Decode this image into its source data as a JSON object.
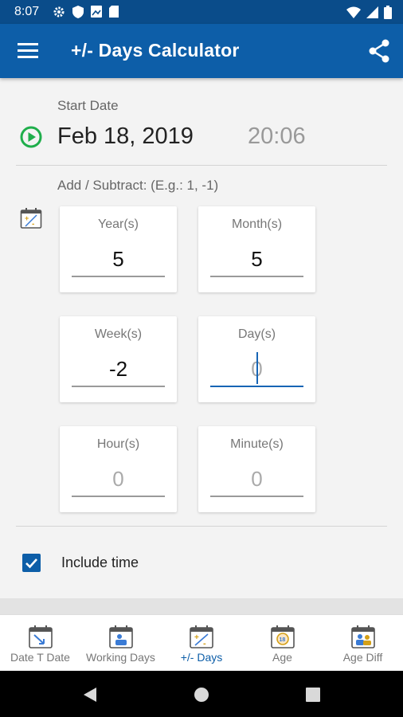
{
  "status_bar": {
    "time": "8:07"
  },
  "app_bar": {
    "title": "+/- Days Calculator"
  },
  "start": {
    "label": "Start Date",
    "date": "Feb 18, 2019",
    "time": "20:06"
  },
  "add_subtract": {
    "label": "Add / Subtract: (E.g.: 1, -1)"
  },
  "fields": {
    "years": {
      "label": "Year(s)",
      "value": "5",
      "placeholder": "0"
    },
    "months": {
      "label": "Month(s)",
      "value": "5",
      "placeholder": "0"
    },
    "weeks": {
      "label": "Week(s)",
      "value": "-2",
      "placeholder": "0"
    },
    "days": {
      "label": "Day(s)",
      "value": "",
      "placeholder": "0"
    },
    "hours": {
      "label": "Hour(s)",
      "value": "",
      "placeholder": "0"
    },
    "minutes": {
      "label": "Minute(s)",
      "value": "",
      "placeholder": "0"
    }
  },
  "include_time": {
    "label": "Include time",
    "checked": true
  },
  "bottom_nav": {
    "items": [
      {
        "label": "Date T Date",
        "icon": "date-to-date-icon"
      },
      {
        "label": "Working Days",
        "icon": "working-days-icon"
      },
      {
        "label": "+/- Days",
        "icon": "plus-minus-days-icon",
        "active": true
      },
      {
        "label": "Age",
        "icon": "age-icon"
      },
      {
        "label": "Age Diff",
        "icon": "age-diff-icon"
      }
    ]
  },
  "colors": {
    "primary": "#0d5ea8",
    "status_bar": "#0a4c8a",
    "start_play": "#1fae4b",
    "focus": "#1765b5"
  }
}
